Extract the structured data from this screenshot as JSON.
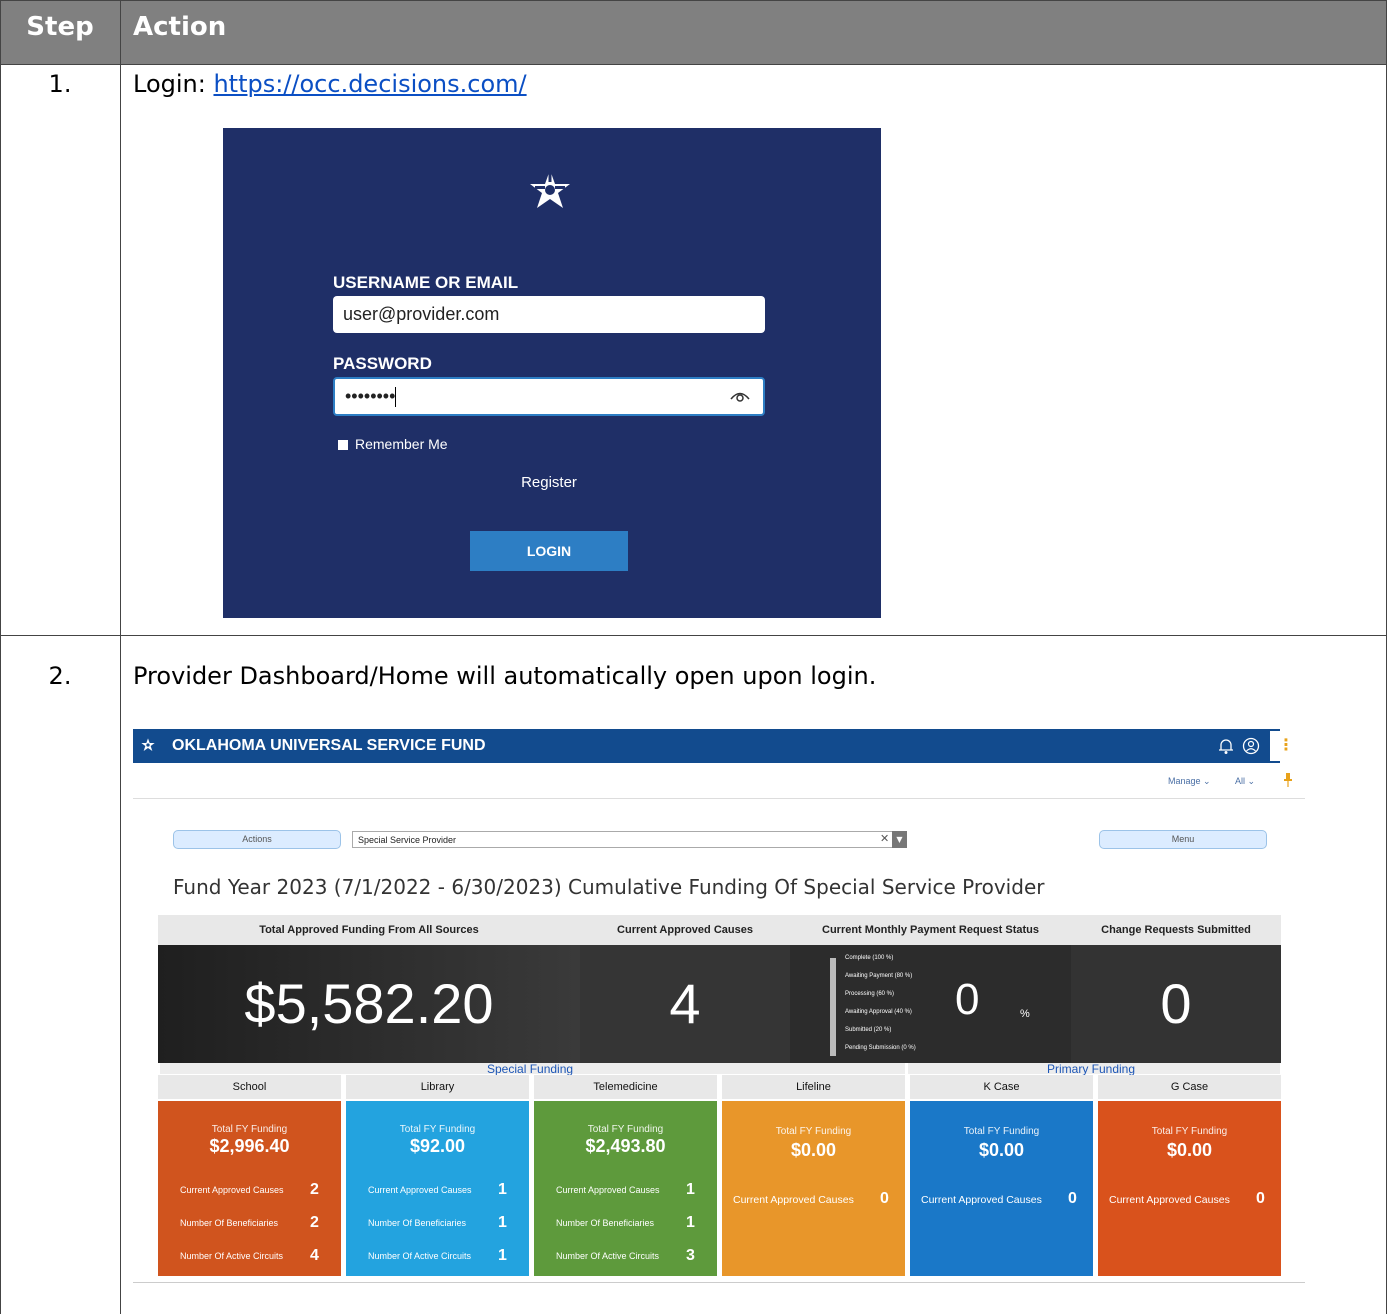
{
  "table": {
    "headers": {
      "step": "Step",
      "action": "Action"
    },
    "steps": [
      {
        "num": "1.",
        "text": "Login: ",
        "link": "https://occ.decisions.com/"
      },
      {
        "num": "2.",
        "text": "Provider Dashboard/Home will automatically open upon login."
      }
    ]
  },
  "login": {
    "username_label": "USERNAME OR EMAIL",
    "username_value": "user@provider.com",
    "password_label": "PASSWORD",
    "password_value": "••••••••",
    "remember_label": "Remember Me",
    "register_label": "Register",
    "login_button": "LOGIN"
  },
  "dashboard": {
    "title": "OKLAHOMA UNIVERSAL SERVICE FUND",
    "manage": "Manage ⌄",
    "all": "All ⌄",
    "actions_button": "Actions",
    "provider_select": "Special Service Provider",
    "menu_button": "Menu",
    "fund_title": "Fund Year 2023 (7/1/2022 - 6/30/2023) Cumulative Funding Of Special Service Provider",
    "kpis": {
      "total_label": "Total Approved Funding From All Sources",
      "total_value": "$5,582.20",
      "causes_label": "Current Approved Causes",
      "causes_value": "4",
      "status_label": "Current Monthly Payment Request Status",
      "status_value": "0",
      "status_unit": "%",
      "status_items": [
        "Complete (100 %)",
        "Awaiting Payment (80 %)",
        "Processing (60 %)",
        "Awaiting Approval (40 %)",
        "Submitted (20 %)",
        "Pending Submission (0 %)"
      ],
      "change_label": "Change Requests Submitted",
      "change_value": "0"
    },
    "sections": {
      "special": "Special Funding",
      "primary": "Primary Funding"
    },
    "cards": [
      {
        "name": "School",
        "color": "#d0541e",
        "funding_label": "Total FY Funding",
        "funding": "$2,996.40",
        "rows": [
          {
            "label": "Current Approved Causes",
            "value": "2"
          },
          {
            "label": "Number Of Beneficiaries",
            "value": "2"
          },
          {
            "label": "Number Of Active Circuits",
            "value": "4"
          }
        ]
      },
      {
        "name": "Library",
        "color": "#23a3df",
        "funding_label": "Total FY Funding",
        "funding": "$92.00",
        "rows": [
          {
            "label": "Current Approved Causes",
            "value": "1"
          },
          {
            "label": "Number Of Beneficiaries",
            "value": "1"
          },
          {
            "label": "Number Of Active Circuits",
            "value": "1"
          }
        ]
      },
      {
        "name": "Telemedicine",
        "color": "#5e9a3c",
        "funding_label": "Total FY Funding",
        "funding": "$2,493.80",
        "rows": [
          {
            "label": "Current Approved Causes",
            "value": "1"
          },
          {
            "label": "Number Of Beneficiaries",
            "value": "1"
          },
          {
            "label": "Number Of Active Circuits",
            "value": "3"
          }
        ]
      },
      {
        "name": "Lifeline",
        "color": "#e8962a",
        "funding_label": "Total FY Funding",
        "funding": "$0.00",
        "rows": [
          {
            "label": "Current Approved Causes",
            "value": "0"
          }
        ]
      },
      {
        "name": "K Case",
        "color": "#1a78c8",
        "funding_label": "Total FY Funding",
        "funding": "$0.00",
        "rows": [
          {
            "label": "Current Approved Causes",
            "value": "0"
          }
        ]
      },
      {
        "name": "G Case",
        "color": "#d9521c",
        "funding_label": "Total FY Funding",
        "funding": "$0.00",
        "rows": [
          {
            "label": "Current Approved Causes",
            "value": "0"
          }
        ]
      }
    ]
  }
}
